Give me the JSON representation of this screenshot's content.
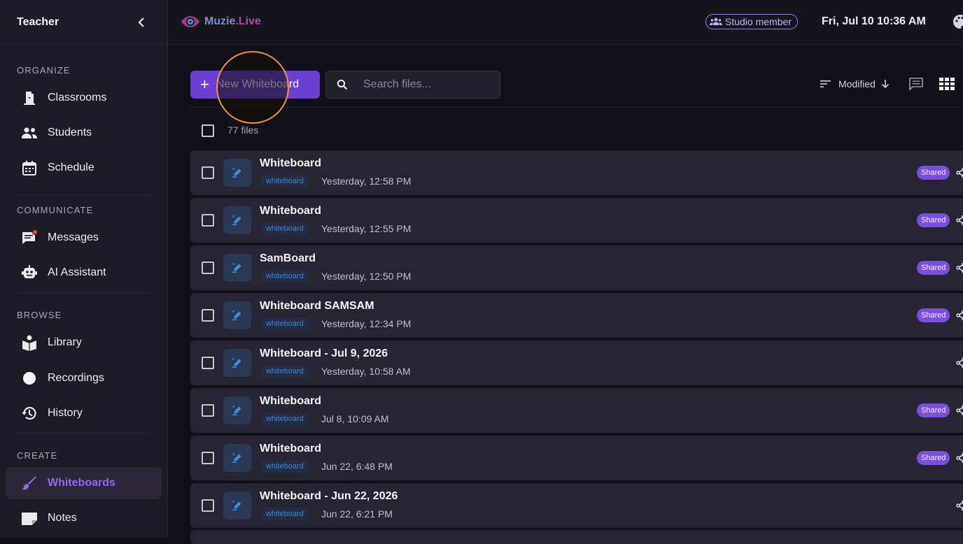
{
  "sidebar": {
    "title": "Teacher",
    "sections": [
      {
        "label": "ORGANIZE",
        "items": [
          {
            "label": "Classrooms",
            "icon": "door-icon"
          },
          {
            "label": "Students",
            "icon": "people-icon"
          },
          {
            "label": "Schedule",
            "icon": "calendar-icon"
          }
        ]
      },
      {
        "label": "COMMUNICATE",
        "items": [
          {
            "label": "Messages",
            "icon": "message-icon"
          },
          {
            "label": "AI Assistant",
            "icon": "robot-icon"
          }
        ]
      },
      {
        "label": "BROWSE",
        "items": [
          {
            "label": "Library",
            "icon": "book-icon"
          },
          {
            "label": "Recordings",
            "icon": "record-icon"
          },
          {
            "label": "History",
            "icon": "history-icon"
          }
        ]
      },
      {
        "label": "CREATE",
        "items": [
          {
            "label": "Whiteboards",
            "icon": "brush-icon",
            "active": true
          },
          {
            "label": "Notes",
            "icon": "note-icon"
          }
        ]
      }
    ]
  },
  "header": {
    "logo_part1": "Muzie",
    "logo_part2": ".Live",
    "badge": "Studio member",
    "datetime": "Fri, Jul 10 10:36 AM"
  },
  "toolbar": {
    "new_button": "New Whiteboard",
    "search_placeholder": "Search files...",
    "sort_label": "Modified",
    "file_count": "77 files"
  },
  "files": [
    {
      "name": "Whiteboard",
      "tag": "whiteboard",
      "date": "Yesterday, 12:58 PM",
      "shared": "Shared"
    },
    {
      "name": "Whiteboard",
      "tag": "whiteboard",
      "date": "Yesterday, 12:55 PM",
      "shared": "Shared"
    },
    {
      "name": "SamBoard",
      "tag": "whiteboard",
      "date": "Yesterday, 12:50 PM",
      "shared": "Shared"
    },
    {
      "name": "Whiteboard SAMSAM",
      "tag": "whiteboard",
      "date": "Yesterday, 12:34 PM",
      "shared": "Shared"
    },
    {
      "name": "Whiteboard - Jul 9, 2026",
      "tag": "whiteboard",
      "date": "Yesterday, 10:58 AM",
      "shared": null
    },
    {
      "name": "Whiteboard",
      "tag": "whiteboard",
      "date": "Jul 8, 10:09 AM",
      "shared": "Shared"
    },
    {
      "name": "Whiteboard",
      "tag": "whiteboard",
      "date": "Jun 22, 6:48 PM",
      "shared": "Shared"
    },
    {
      "name": "Whiteboard - Jun 22, 2026",
      "tag": "whiteboard",
      "date": "Jun 22, 6:21 PM",
      "shared": null
    }
  ],
  "colors": {
    "accent": "#6a3fd2",
    "active_nav": "#8f6bf0",
    "shared_badge": "#7b4fdc",
    "tag_text": "#3b86d8",
    "click_ring": "#f2923a"
  }
}
